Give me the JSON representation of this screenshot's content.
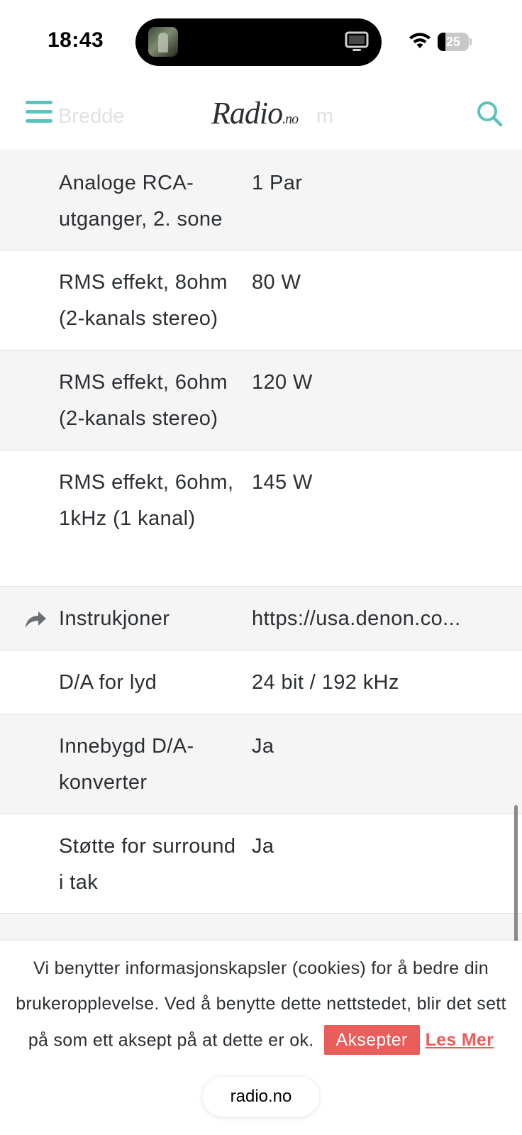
{
  "status_bar": {
    "time": "18:43",
    "battery_level": "25",
    "battery_fraction": 0.25,
    "icons": [
      "wifi-icon",
      "battery-icon",
      "screen-mirroring-icon"
    ]
  },
  "header": {
    "logo_main": "Radio",
    "logo_suffix": ".no",
    "ghost_left": "Bredde",
    "ghost_right": "m",
    "accent_color": "#5cc2bd"
  },
  "spec_rows": [
    {
      "label": "Analoge RCA-utganger, 2. sone",
      "value": "1 Par",
      "link": false
    },
    {
      "label": "RMS effekt, 8ohm (2-kanals stereo)",
      "value": "80 W",
      "link": false
    },
    {
      "label": "RMS effekt, 6ohm (2-kanals stereo)",
      "value": "120 W",
      "link": false
    },
    {
      "label": "RMS effekt, 6ohm, 1kHz (1 kanal)",
      "value": "145 W",
      "link": false
    },
    {
      "label": "Instrukjoner",
      "value": "https://usa.denon.co...",
      "link": true
    },
    {
      "label": "D/A for lyd",
      "value": "24 bit / 192 kHz",
      "link": false
    },
    {
      "label": "Innebygd D/A-konverter",
      "value": "Ja",
      "link": false
    },
    {
      "label": "Støtte for surround i tak",
      "value": "Ja",
      "link": false
    }
  ],
  "cookie": {
    "line1": "Vi benytter informasjonskapsler (cookies) for å bedre din",
    "line2": "brukeropplevelse. Ved å benytte dette nettstedet, blir det sett",
    "line3": "på som ett aksept på at dette er ok.",
    "accept_label": "Aksepter",
    "read_more_label": "Les Mer",
    "accent_color": "#ea5d5a"
  },
  "browser": {
    "url": "radio.no"
  }
}
